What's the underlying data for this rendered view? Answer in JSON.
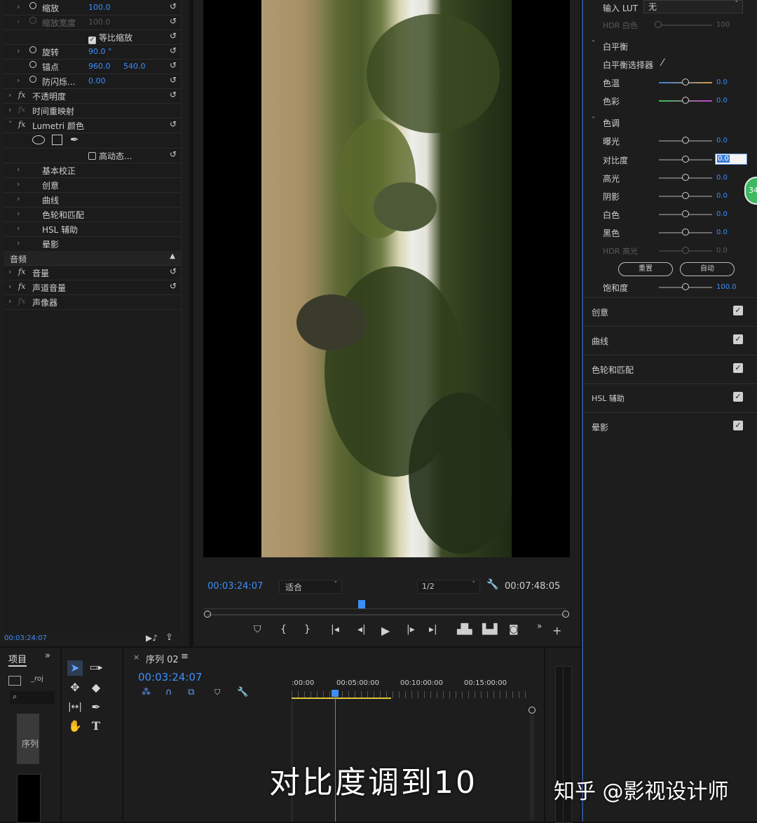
{
  "effect_controls": {
    "motion": {
      "scale": {
        "label": "缩放",
        "value": "100.0"
      },
      "scale_width": {
        "label": "缩放宽度",
        "value": "100.0"
      },
      "uniform_scale": {
        "label": "等比缩放",
        "checked": true
      },
      "rotation": {
        "label": "旋转",
        "value": "90.0 °"
      },
      "anchor": {
        "label": "锚点",
        "x": "960.0",
        "y": "540.0"
      },
      "anti_flicker": {
        "label": "防闪烁...",
        "value": "0.00"
      }
    },
    "opacity": "不透明度",
    "time_remap": "时间重映射",
    "lumetri": {
      "name": "Lumetri 颜色",
      "hdr": "高动态...",
      "sections": [
        "基本校正",
        "创意",
        "曲线",
        "色轮和匹配",
        "HSL 辅助",
        "晕影"
      ]
    },
    "audio_header": "音频",
    "audio": {
      "volume": "音量",
      "channel_volume": "声道音量",
      "panner": "声像器"
    },
    "timecode": "00:03:24:07"
  },
  "program_monitor": {
    "timecode": "00:03:24:07",
    "fit": "适合",
    "resolution": "1/2",
    "duration": "00:07:48:05",
    "playhead_fraction": 0.43
  },
  "lumetri_panel": {
    "input_lut": {
      "label": "输入 LUT",
      "value": "无"
    },
    "hdr_white": {
      "label": "HDR 白色",
      "value": "100"
    },
    "white_balance": {
      "title": "白平衡",
      "picker": "白平衡选择器",
      "temperature": {
        "label": "色温",
        "value": "0.0"
      },
      "tint": {
        "label": "色彩",
        "value": "0.0"
      }
    },
    "tone": {
      "title": "色调",
      "exposure": {
        "label": "曝光",
        "value": "0.0"
      },
      "contrast": {
        "label": "对比度",
        "value": "0.0"
      },
      "highlights": {
        "label": "高光",
        "value": "0.0"
      },
      "shadows": {
        "label": "阴影",
        "value": "0.0"
      },
      "whites": {
        "label": "白色",
        "value": "0.0"
      },
      "blacks": {
        "label": "黑色",
        "value": "0.0"
      },
      "hdr_highlights": {
        "label": "HDR 高光",
        "value": "0.0"
      }
    },
    "reset_button": "重置",
    "auto_button": "自动",
    "saturation": {
      "label": "饱和度",
      "value": "100.0"
    },
    "sections": [
      "创意",
      "曲线",
      "色轮和匹配",
      "HSL 辅助",
      "晕影"
    ],
    "badge": "34"
  },
  "project_panel": {
    "title": "项目",
    "file": "_roj",
    "bin": "序列"
  },
  "timeline": {
    "sequence": "序列 02",
    "timecode": "00:03:24:07",
    "ruler": [
      ":00:00",
      "00:05:00:00",
      "00:10:00:00",
      "00:15:00:00"
    ]
  },
  "subtitle": "对比度调到10",
  "watermark": "知乎 @影视设计师"
}
